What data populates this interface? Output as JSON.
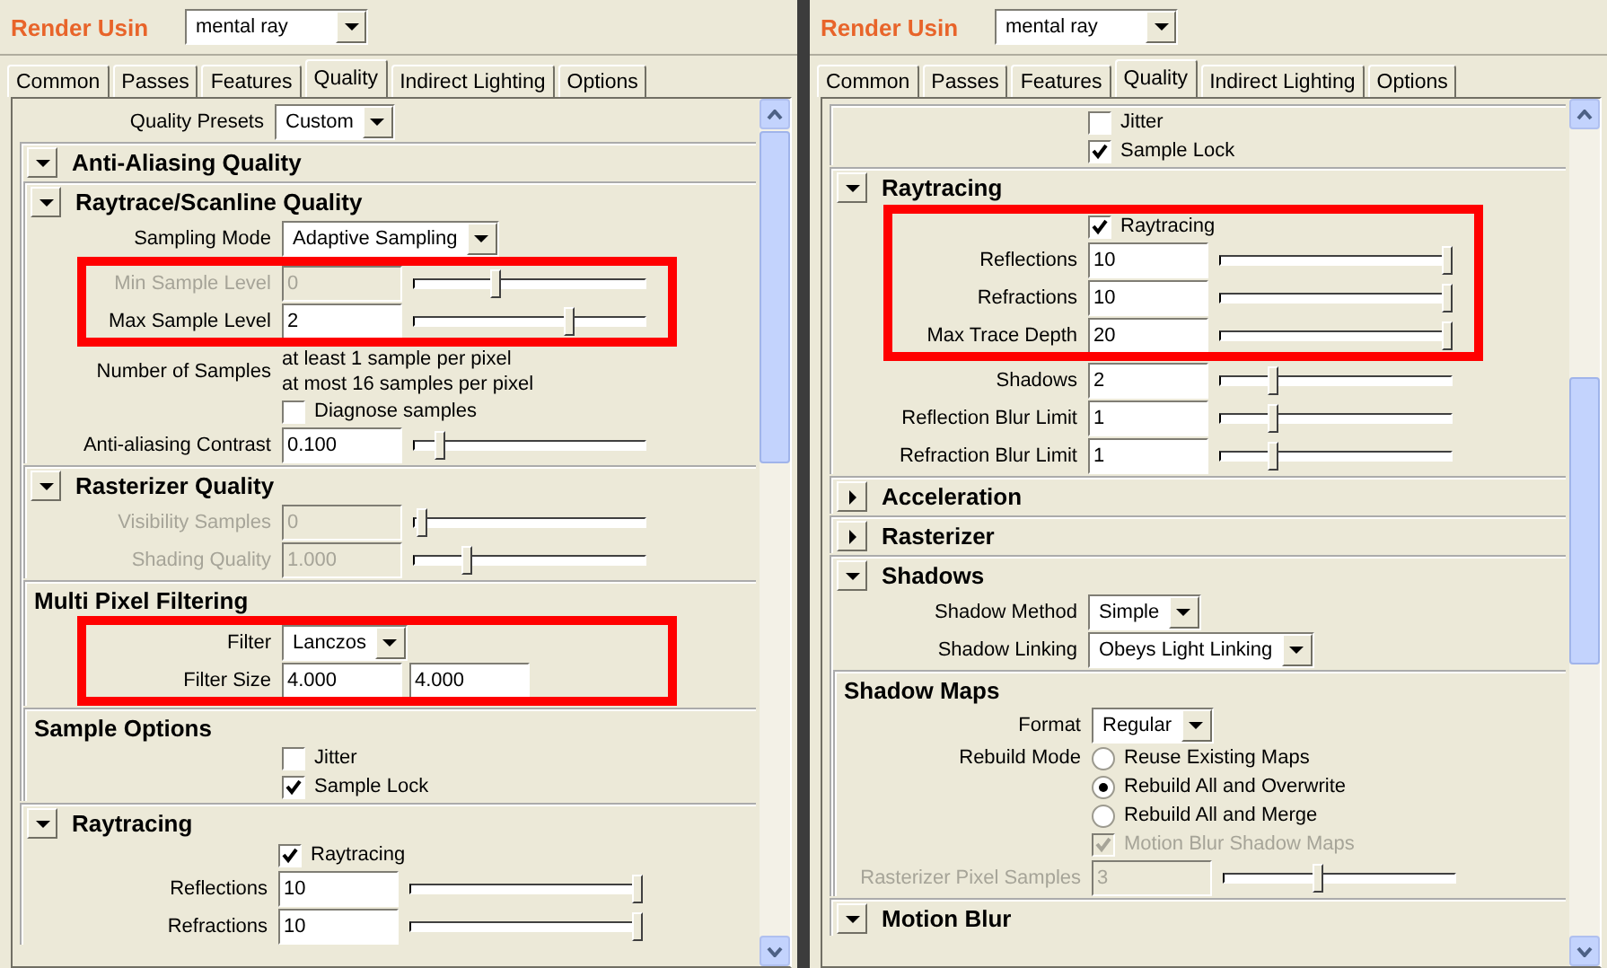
{
  "panels": [
    {
      "render_using": {
        "label": "Render Usin",
        "value": "mental ray"
      },
      "tabs": [
        {
          "label": "Common",
          "selected": false
        },
        {
          "label": "Passes",
          "selected": false
        },
        {
          "label": "Features",
          "selected": false
        },
        {
          "label": "Quality",
          "selected": true
        },
        {
          "label": "Indirect Lighting",
          "selected": false
        },
        {
          "label": "Options",
          "selected": false
        }
      ],
      "content": [
        {
          "kind": "dropdown",
          "label": "Quality Presets",
          "value": "Custom"
        },
        {
          "kind": "section",
          "title": "Anti-Aliasing Quality",
          "expanded": true,
          "children": [
            {
              "kind": "section",
              "title": "Raytrace/Scanline Quality",
              "expanded": true,
              "children": [
                {
                  "kind": "dropdown",
                  "label": "Sampling Mode",
                  "value": "Adaptive Sampling"
                },
                {
                  "kind": "highlight",
                  "children": [
                    {
                      "kind": "slider",
                      "label": "Min Sample Level",
                      "value": "0",
                      "level": 0.35,
                      "disabled": true
                    },
                    {
                      "kind": "slider",
                      "label": "Max Sample Level",
                      "value": "2",
                      "level": 0.68,
                      "disabled": false
                    }
                  ]
                },
                {
                  "kind": "text",
                  "label": "Number of Samples",
                  "lines": [
                    "at least 1 sample per pixel",
                    "at most 16 samples per pixel"
                  ]
                },
                {
                  "kind": "checkbox",
                  "label": "Diagnose samples",
                  "checked": false,
                  "disabled": false
                },
                {
                  "kind": "slider",
                  "label": "Anti-aliasing Contrast",
                  "value": "0.100",
                  "level": 0.1,
                  "disabled": false
                }
              ]
            },
            {
              "kind": "section",
              "title": "Rasterizer Quality",
              "expanded": true,
              "children": [
                {
                  "kind": "slider",
                  "label": "Visibility Samples",
                  "value": "0",
                  "level": 0.02,
                  "disabled": true
                },
                {
                  "kind": "slider",
                  "label": "Shading Quality",
                  "value": "1.000",
                  "level": 0.22,
                  "disabled": true
                }
              ]
            },
            {
              "kind": "group",
              "title": "Multi Pixel Filtering",
              "children": [
                {
                  "kind": "highlight",
                  "children": [
                    {
                      "kind": "dropdown",
                      "label": "Filter",
                      "value": "Lanczos"
                    },
                    {
                      "kind": "fields",
                      "label": "Filter Size",
                      "values": [
                        "4.000",
                        "4.000"
                      ]
                    }
                  ]
                }
              ]
            },
            {
              "kind": "group",
              "title": "Sample Options",
              "children": [
                {
                  "kind": "checkbox",
                  "label": "Jitter",
                  "checked": false,
                  "disabled": false
                },
                {
                  "kind": "checkbox",
                  "label": "Sample Lock",
                  "checked": true,
                  "disabled": false
                }
              ]
            }
          ]
        },
        {
          "kind": "section",
          "title": "Raytracing",
          "expanded": true,
          "children": [
            {
              "kind": "checkbox",
              "label": "Raytracing",
              "checked": true,
              "disabled": false
            },
            {
              "kind": "slider",
              "label": "Reflections",
              "value": "10",
              "level": 1.0,
              "disabled": false
            },
            {
              "kind": "slider",
              "label": "Refractions",
              "value": "10",
              "level": 1.0,
              "disabled": false
            }
          ]
        }
      ]
    },
    {
      "render_using": {
        "label": "Render Usin",
        "value": "mental ray"
      },
      "tabs": [
        {
          "label": "Common",
          "selected": false
        },
        {
          "label": "Passes",
          "selected": false
        },
        {
          "label": "Features",
          "selected": false
        },
        {
          "label": "Quality",
          "selected": true
        },
        {
          "label": "Indirect Lighting",
          "selected": false
        },
        {
          "label": "Options",
          "selected": false
        }
      ],
      "content": [
        {
          "kind": "group",
          "children": [
            {
              "kind": "checkbox",
              "label": "Jitter",
              "checked": false,
              "disabled": false
            },
            {
              "kind": "checkbox",
              "label": "Sample Lock",
              "checked": true,
              "disabled": false
            }
          ]
        },
        {
          "kind": "section",
          "title": "Raytracing",
          "expanded": true,
          "children": [
            {
              "kind": "highlight",
              "children": [
                {
                  "kind": "checkbox",
                  "label": "Raytracing",
                  "checked": true,
                  "disabled": false
                },
                {
                  "kind": "slider",
                  "label": "Reflections",
                  "value": "10",
                  "level": 1.0,
                  "disabled": false
                },
                {
                  "kind": "slider",
                  "label": "Refractions",
                  "value": "10",
                  "level": 1.0,
                  "disabled": false
                },
                {
                  "kind": "slider",
                  "label": "Max Trace Depth",
                  "value": "20",
                  "level": 1.0,
                  "disabled": false
                }
              ]
            },
            {
              "kind": "slider",
              "label": "Shadows",
              "value": "2",
              "level": 0.22,
              "disabled": false
            },
            {
              "kind": "slider",
              "label": "Reflection Blur Limit",
              "value": "1",
              "level": 0.22,
              "disabled": false
            },
            {
              "kind": "slider",
              "label": "Refraction Blur Limit",
              "value": "1",
              "level": 0.22,
              "disabled": false
            }
          ]
        },
        {
          "kind": "section",
          "title": "Acceleration",
          "expanded": false
        },
        {
          "kind": "section",
          "title": "Rasterizer",
          "expanded": false
        },
        {
          "kind": "section",
          "title": "Shadows",
          "expanded": true,
          "children": [
            {
              "kind": "dropdown",
              "label": "Shadow Method",
              "value": "Simple"
            },
            {
              "kind": "dropdown",
              "label": "Shadow Linking",
              "value": "Obeys Light Linking"
            },
            {
              "kind": "group",
              "title": "Shadow Maps",
              "children": [
                {
                  "kind": "dropdown",
                  "label": "Format",
                  "value": "Regular"
                },
                {
                  "kind": "radio",
                  "label": "Rebuild Mode",
                  "options": [
                    {
                      "label": "Reuse Existing Maps",
                      "selected": false
                    },
                    {
                      "label": "Rebuild All and Overwrite",
                      "selected": true
                    },
                    {
                      "label": "Rebuild All and Merge",
                      "selected": false
                    }
                  ]
                },
                {
                  "kind": "checkbox",
                  "label": "Motion Blur Shadow Maps",
                  "checked": true,
                  "disabled": true
                },
                {
                  "kind": "slider",
                  "label": "Rasterizer Pixel Samples",
                  "value": "3",
                  "level": 0.4,
                  "disabled": true
                }
              ]
            }
          ]
        },
        {
          "kind": "section",
          "title": "Motion Blur",
          "expanded": true
        }
      ]
    }
  ]
}
